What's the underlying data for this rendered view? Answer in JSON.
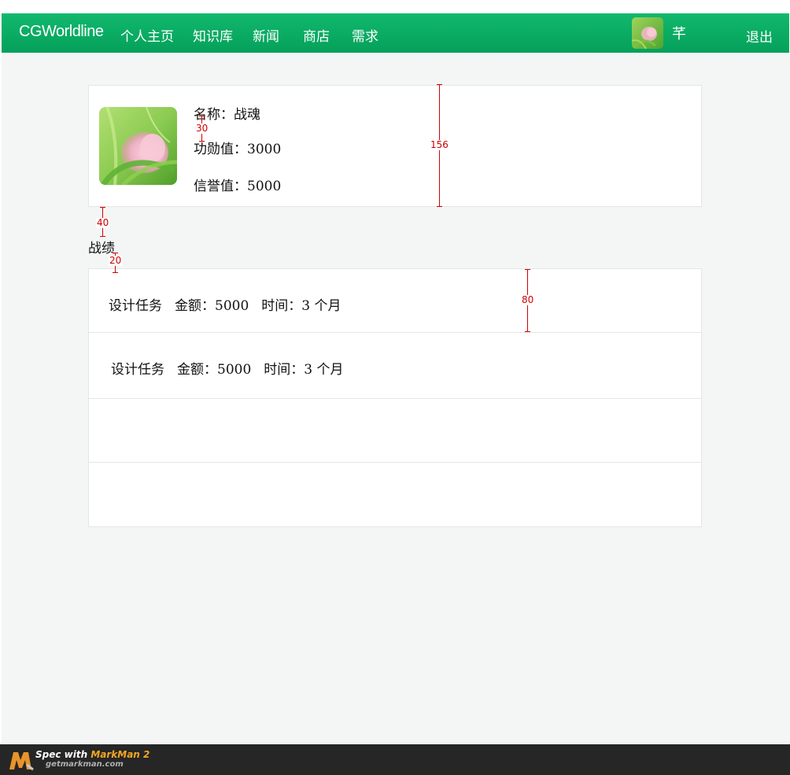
{
  "navbar": {
    "brand": "CGWorldline",
    "items": [
      {
        "label": "个人主页"
      },
      {
        "label": "知识库"
      },
      {
        "label": "新闻"
      },
      {
        "label": "商店"
      },
      {
        "label": "需求"
      }
    ],
    "username": "芊",
    "logout_label": "退出",
    "accent_color": "#05a05b"
  },
  "profile": {
    "name_line": "名称：战魂",
    "merit_line": "功勋值：3000",
    "credit_line": "信誉值：5000"
  },
  "section_title": "战绩",
  "records": [
    {
      "task": "设计任务",
      "amount": "金额：5000",
      "time": "时间：3 个月"
    },
    {
      "task": "设计任务",
      "amount": "金额：5000",
      "time": "时间：3 个月"
    },
    {
      "task": "",
      "amount": "",
      "time": ""
    },
    {
      "task": "",
      "amount": "",
      "time": ""
    }
  ],
  "annotations": {
    "name_gap": "30",
    "card_height": "156",
    "section_gap": "40",
    "title_gap": "20",
    "row_height": "80"
  },
  "footer": {
    "spec_prefix": "Spec with ",
    "spec_product": "MarkMan 2",
    "site": "getmarkman.com"
  }
}
